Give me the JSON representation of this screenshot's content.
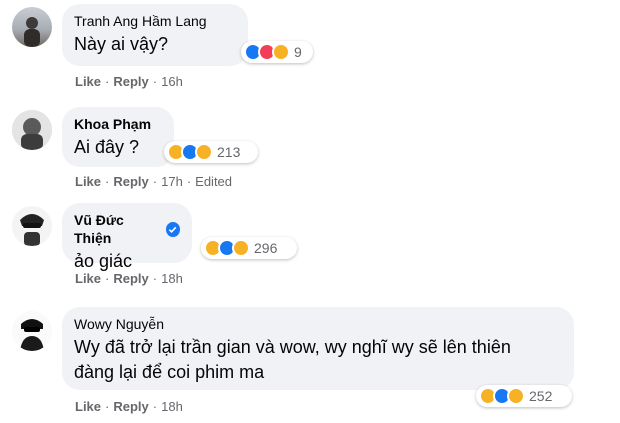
{
  "comments": [
    {
      "author": "Tranh Ang Hầm Lang",
      "text": "Này ai vậy?",
      "verified": false,
      "reactions": [
        "like",
        "love",
        "haha"
      ],
      "reaction_count": "9",
      "like_label": "Like",
      "reply_label": "Reply",
      "time": "16h",
      "edited": ""
    },
    {
      "author": "Khoa Phạm",
      "text": "Ai đây ?",
      "verified": false,
      "reactions": [
        "haha",
        "like",
        "sad"
      ],
      "reaction_count": "213",
      "like_label": "Like",
      "reply_label": "Reply",
      "time": "17h",
      "edited": "Edited"
    },
    {
      "author": "Vũ Đức Thiện",
      "text": "ảo giác",
      "verified": true,
      "reactions": [
        "haha",
        "like",
        "sad"
      ],
      "reaction_count": "296",
      "like_label": "Like",
      "reply_label": "Reply",
      "time": "18h",
      "edited": ""
    },
    {
      "author": "Wowy Nguyễn",
      "text": "Wy đã trở lại trần gian và wow, wy nghĩ wy sẽ lên thiên đàng lại để coi phim ma",
      "verified": false,
      "reactions": [
        "haha",
        "like",
        "sad"
      ],
      "reaction_count": "252",
      "like_label": "Like",
      "reply_label": "Reply",
      "time": "18h",
      "edited": ""
    }
  ],
  "separator": "·",
  "colors": {
    "bubble": "#f0f2f5",
    "like": "#1877f2",
    "love": "#f33e58",
    "haha": "#f7b125",
    "meta": "#65676b"
  }
}
